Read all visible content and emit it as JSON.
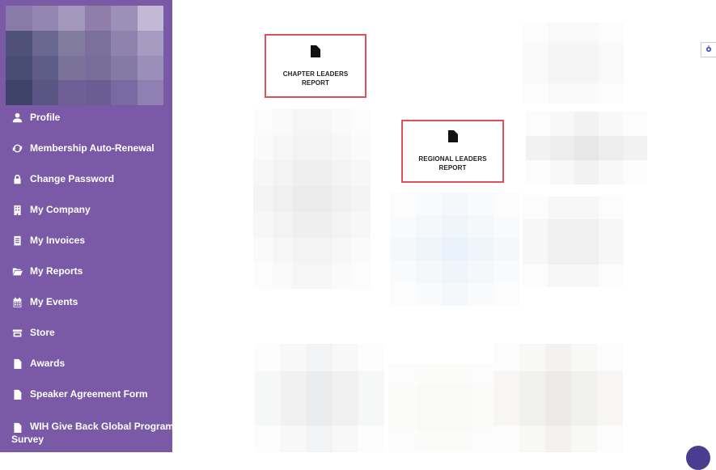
{
  "sidebar": {
    "bg_color": "#7a5aa6",
    "items": [
      {
        "label": "Profile",
        "icon": "user-icon"
      },
      {
        "label": "Membership Auto-Renewal",
        "icon": "refresh-icon"
      },
      {
        "label": "Change Password",
        "icon": "lock-icon"
      },
      {
        "label": "My Company",
        "icon": "building-icon"
      },
      {
        "label": "My Invoices",
        "icon": "receipt-icon"
      },
      {
        "label": "My Reports",
        "icon": "folder-open-icon"
      },
      {
        "label": "My Events",
        "icon": "calendar-icon"
      },
      {
        "label": "Store",
        "icon": "store-icon"
      },
      {
        "label": "Awards",
        "icon": "document-icon"
      },
      {
        "label": "Speaker Agreement Form",
        "icon": "document-icon"
      },
      {
        "label_line1": "WIH Give Back Global Program",
        "label_line2": "Survey",
        "icon": "document-icon"
      }
    ]
  },
  "main": {
    "reports": [
      {
        "line1": "CHAPTER LEADERS",
        "line2": "REPORT",
        "icon": "document-icon"
      },
      {
        "line1": "REGIONAL LEADERS",
        "line2": "REPORT",
        "icon": "document-icon"
      }
    ],
    "highlight_color": "#e0505a"
  },
  "widgets": {
    "settings_icon": "gear-icon",
    "chat_icon": "chat-icon"
  }
}
